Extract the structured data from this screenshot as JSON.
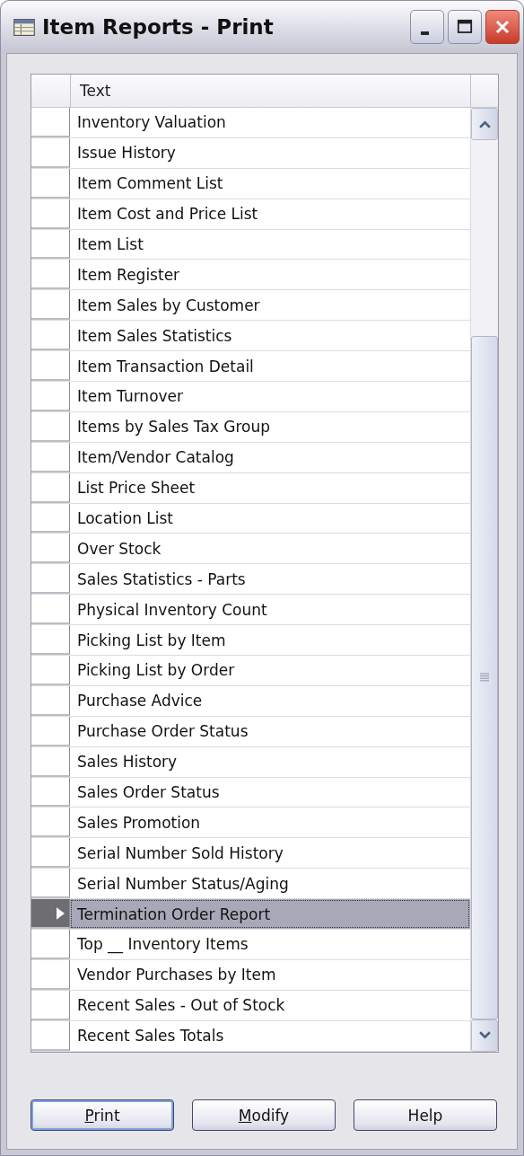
{
  "window": {
    "title": "Item Reports - Print"
  },
  "table": {
    "columns": [
      "Text"
    ],
    "rows": [
      {
        "text": "Inventory Valuation",
        "selected": false
      },
      {
        "text": "Issue History",
        "selected": false
      },
      {
        "text": "Item Comment List",
        "selected": false
      },
      {
        "text": "Item Cost and Price List",
        "selected": false
      },
      {
        "text": "Item List",
        "selected": false
      },
      {
        "text": "Item Register",
        "selected": false
      },
      {
        "text": "Item Sales by Customer",
        "selected": false
      },
      {
        "text": "Item Sales Statistics",
        "selected": false
      },
      {
        "text": "Item Transaction Detail",
        "selected": false
      },
      {
        "text": "Item Turnover",
        "selected": false
      },
      {
        "text": "Items by Sales Tax Group",
        "selected": false
      },
      {
        "text": "Item/Vendor Catalog",
        "selected": false
      },
      {
        "text": "List Price Sheet",
        "selected": false
      },
      {
        "text": "Location List",
        "selected": false
      },
      {
        "text": "Over Stock",
        "selected": false
      },
      {
        "text": "Sales Statistics - Parts",
        "selected": false
      },
      {
        "text": "Physical Inventory Count",
        "selected": false
      },
      {
        "text": "Picking List by Item",
        "selected": false
      },
      {
        "text": "Picking List by Order",
        "selected": false
      },
      {
        "text": "Purchase Advice",
        "selected": false
      },
      {
        "text": "Purchase Order Status",
        "selected": false
      },
      {
        "text": "Sales History",
        "selected": false
      },
      {
        "text": "Sales Order Status",
        "selected": false
      },
      {
        "text": "Sales Promotion",
        "selected": false
      },
      {
        "text": "Serial Number Sold History",
        "selected": false
      },
      {
        "text": "Serial Number Status/Aging",
        "selected": false
      },
      {
        "text": "Termination Order Report",
        "selected": true
      },
      {
        "text": "Top __ Inventory Items",
        "selected": false
      },
      {
        "text": "Vendor Purchases by Item",
        "selected": false
      },
      {
        "text": "Recent Sales - Out of Stock",
        "selected": false
      },
      {
        "text": "Recent Sales Totals",
        "selected": false
      }
    ]
  },
  "buttons": [
    {
      "label": "Print",
      "underline_first": true,
      "focused": true
    },
    {
      "label": "Modify",
      "underline_first": true,
      "focused": false
    },
    {
      "label": "Help",
      "underline_first": false,
      "focused": false
    }
  ]
}
